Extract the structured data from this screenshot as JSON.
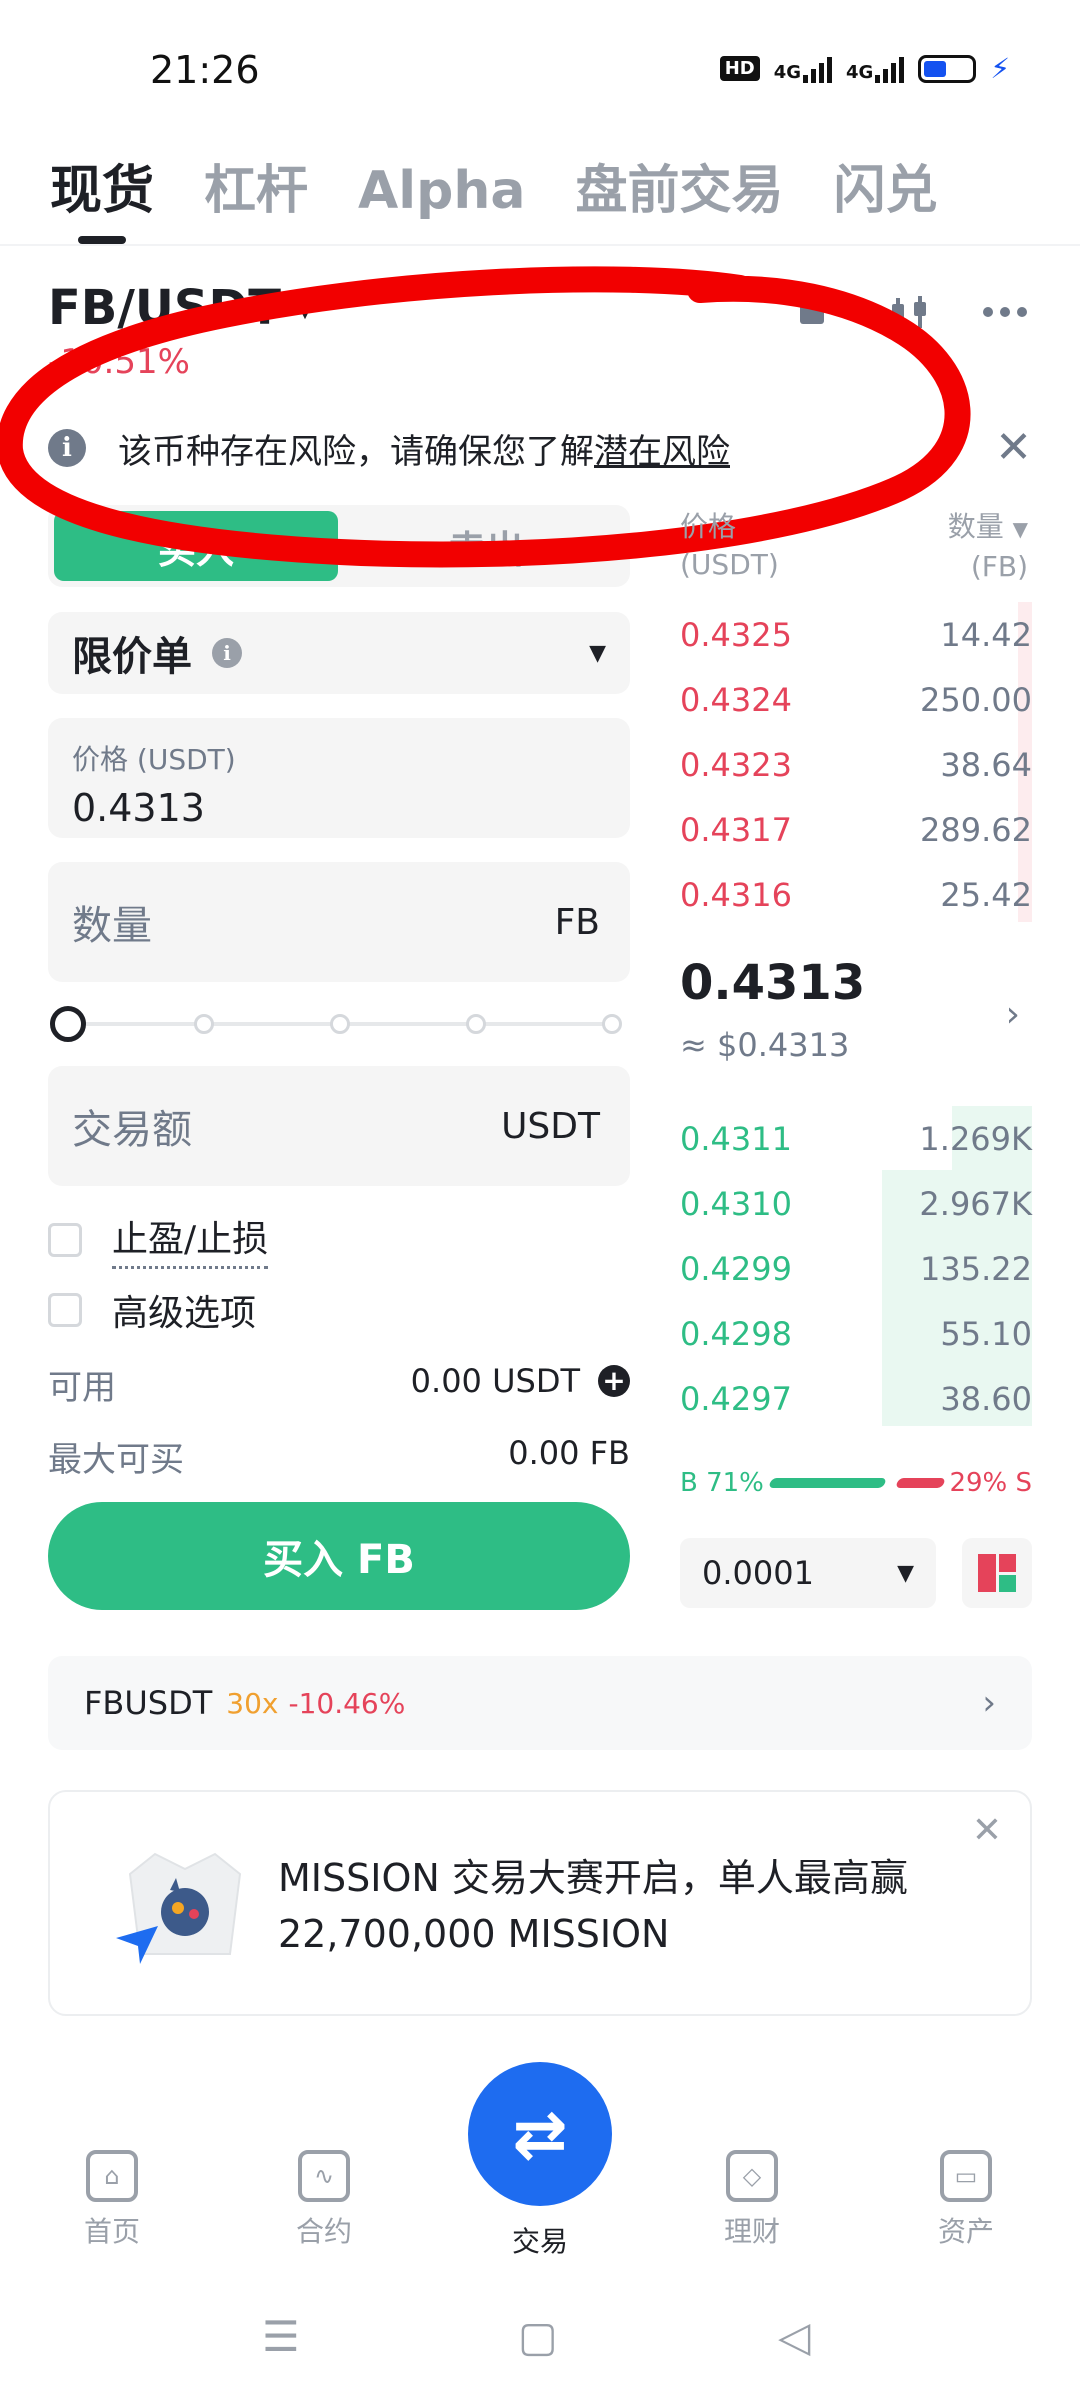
{
  "status": {
    "time": "21:26",
    "hd": "HD",
    "net1": "4G",
    "net2": "4G"
  },
  "tabs": [
    "现货",
    "杠杆",
    "Alpha",
    "盘前交易",
    "闪兑"
  ],
  "pair": {
    "symbol": "FB/USDT",
    "change": "-10.51%"
  },
  "risk": {
    "text": "该币种存在风险，请确保您了解",
    "link": "潜在风险"
  },
  "toggle": {
    "buy": "买入",
    "sell": "卖出"
  },
  "form": {
    "order_type": "限价单",
    "price_label": "价格 (USDT)",
    "price_value": "0.4313",
    "qty_placeholder": "数量",
    "qty_unit": "FB",
    "amount_placeholder": "交易额",
    "amount_unit": "USDT",
    "tpsl": "止盈/止损",
    "advanced": "高级选项",
    "available_label": "可用",
    "available_value": "0.00 USDT",
    "max_buy_label": "最大可买",
    "max_buy_value": "0.00 FB",
    "buy_button": "买入 FB"
  },
  "orderbook": {
    "price_header": "价格",
    "price_unit": "(USDT)",
    "qty_header": "数量",
    "qty_unit": "(FB)",
    "asks": [
      {
        "price": "0.4325",
        "qty": "14.42"
      },
      {
        "price": "0.4324",
        "qty": "250.00"
      },
      {
        "price": "0.4323",
        "qty": "38.64"
      },
      {
        "price": "0.4317",
        "qty": "289.62"
      },
      {
        "price": "0.4316",
        "qty": "25.42"
      }
    ],
    "last_price": "0.4313",
    "last_usd": "≈ $0.4313",
    "bids": [
      {
        "price": "0.4311",
        "qty": "1.269K"
      },
      {
        "price": "0.4310",
        "qty": "2.967K"
      },
      {
        "price": "0.4299",
        "qty": "135.22"
      },
      {
        "price": "0.4298",
        "qty": "55.10"
      },
      {
        "price": "0.4297",
        "qty": "38.60"
      }
    ],
    "buy_ratio": "B 71%",
    "sell_ratio": "29% S",
    "buy_ratio_value": 0.71,
    "precision": "0.0001"
  },
  "futures": {
    "symbol": "FBUSDT",
    "leverage": "30x",
    "change": "-10.46%"
  },
  "promo": {
    "text": "MISSION 交易大赛开启，单人最高赢 22,700,000 MISSION"
  },
  "nav": {
    "home": "首页",
    "futures": "合约",
    "trade": "交易",
    "earn": "理财",
    "assets": "资产"
  },
  "colors": {
    "buy": "#2ebd85",
    "sell": "#e5435a",
    "annotation": "#f20000",
    "fab": "#1e6cf0"
  }
}
